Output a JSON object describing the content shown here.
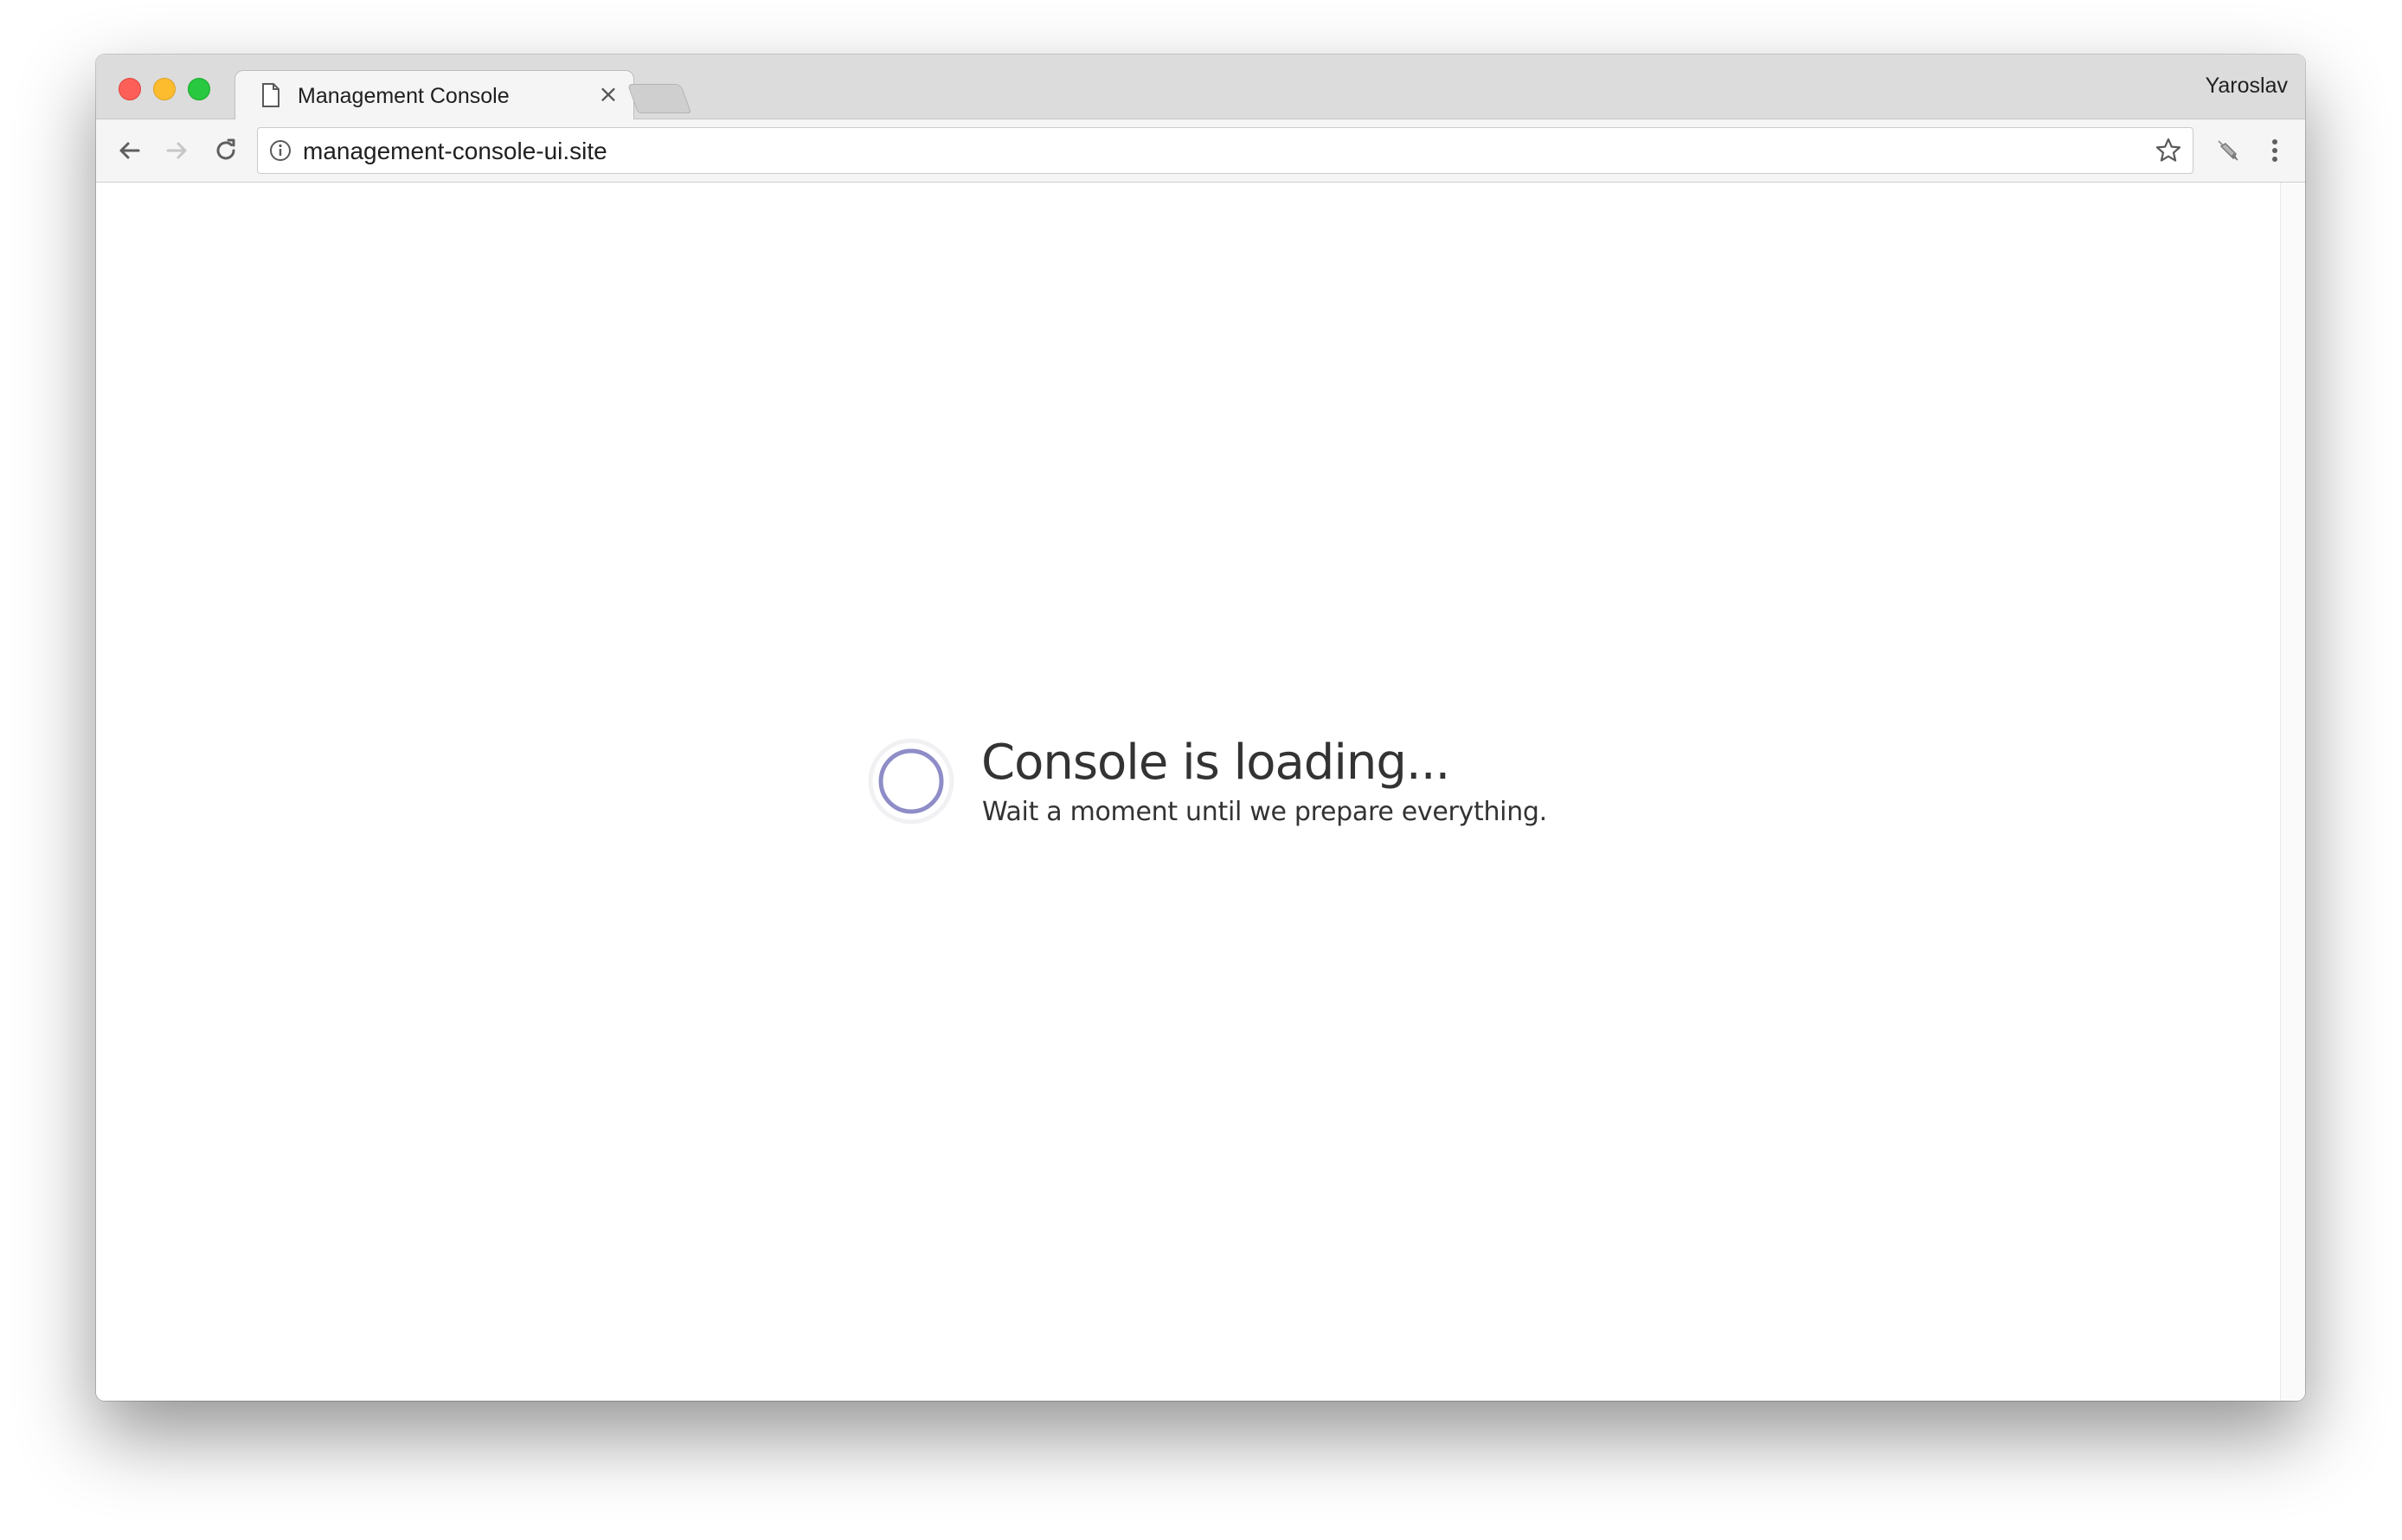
{
  "window": {
    "controls": [
      "close",
      "minimize",
      "maximize"
    ]
  },
  "tabs": [
    {
      "title": "Management Console",
      "icon": "document-icon",
      "close_glyph": "×"
    }
  ],
  "profile": {
    "name": "Yaroslav"
  },
  "toolbar": {
    "back_icon": "arrow-left-icon",
    "forward_icon": "arrow-right-icon",
    "reload_icon": "reload-icon",
    "bookmark_icon": "star-icon",
    "extension_icon": "extension-icon",
    "menu_icon": "kebab-menu-icon"
  },
  "omnibox": {
    "url": "management-console-ui.site",
    "security_icon": "info-icon"
  },
  "page": {
    "title": "Console is loading...",
    "subtitle": "Wait a moment until we prepare everything.",
    "spinner_color": "#8e8dc7"
  }
}
